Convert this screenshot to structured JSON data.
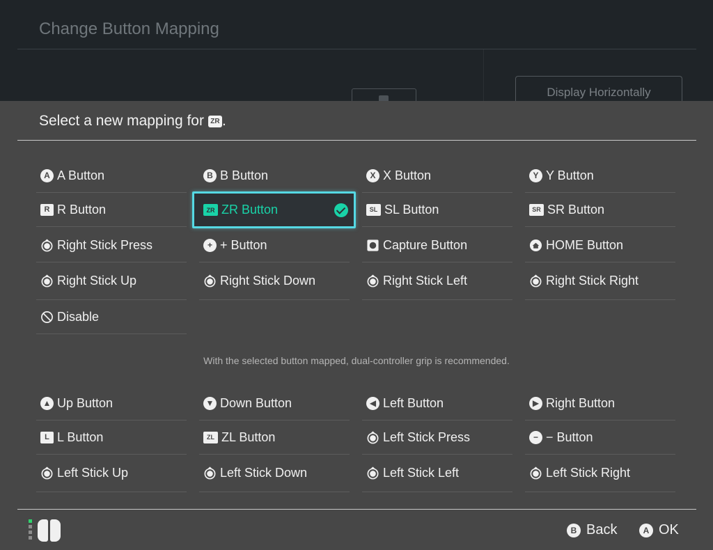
{
  "background": {
    "title": "Change Button Mapping",
    "display_button_label": "Display Horizontally"
  },
  "prompt": {
    "text_before": "Select a new mapping for",
    "icon_label": "ZR",
    "text_after": "."
  },
  "options_primary": [
    {
      "label": "A Button",
      "icon": "a-button-icon",
      "glyph": "A"
    },
    {
      "label": "B Button",
      "icon": "b-button-icon",
      "glyph": "B"
    },
    {
      "label": "X Button",
      "icon": "x-button-icon",
      "glyph": "X"
    },
    {
      "label": "Y Button",
      "icon": "y-button-icon",
      "glyph": "Y"
    },
    {
      "label": "R Button",
      "icon": "r-button-icon",
      "glyph": "R"
    },
    {
      "label": "ZR Button",
      "icon": "zr-button-icon",
      "glyph": "ZR",
      "selected": true
    },
    {
      "label": "SL Button",
      "icon": "sl-button-icon",
      "glyph": "SL"
    },
    {
      "label": "SR Button",
      "icon": "sr-button-icon",
      "glyph": "SR"
    },
    {
      "label": "Right Stick Press",
      "icon": "right-stick-press-icon",
      "glyph": "R"
    },
    {
      "label": "+ Button",
      "icon": "plus-button-icon",
      "glyph": "+"
    },
    {
      "label": "Capture Button",
      "icon": "capture-button-icon",
      "glyph": ""
    },
    {
      "label": "HOME Button",
      "icon": "home-button-icon",
      "glyph": ""
    },
    {
      "label": "Right Stick Up",
      "icon": "right-stick-up-icon",
      "glyph": "R"
    },
    {
      "label": "Right Stick Down",
      "icon": "right-stick-down-icon",
      "glyph": "R"
    },
    {
      "label": "Right Stick Left",
      "icon": "right-stick-left-icon",
      "glyph": "R"
    },
    {
      "label": "Right Stick Right",
      "icon": "right-stick-right-icon",
      "glyph": "R"
    },
    {
      "label": "Disable",
      "icon": "disable-icon",
      "glyph": ""
    }
  ],
  "grip_note": "With the selected button mapped, dual-controller grip is recommended.",
  "options_secondary": [
    {
      "label": "Up Button",
      "icon": "up-button-icon",
      "glyph": "▲"
    },
    {
      "label": "Down Button",
      "icon": "down-button-icon",
      "glyph": "▼"
    },
    {
      "label": "Left Button",
      "icon": "left-button-icon",
      "glyph": "◀"
    },
    {
      "label": "Right Button",
      "icon": "right-button-icon",
      "glyph": "▶"
    },
    {
      "label": "L Button",
      "icon": "l-button-icon",
      "glyph": "L"
    },
    {
      "label": "ZL Button",
      "icon": "zl-button-icon",
      "glyph": "ZL"
    },
    {
      "label": "Left Stick Press",
      "icon": "left-stick-press-icon",
      "glyph": "L"
    },
    {
      "label": "− Button",
      "icon": "minus-button-icon",
      "glyph": "−"
    },
    {
      "label": "Left Stick Up",
      "icon": "left-stick-up-icon",
      "glyph": "L"
    },
    {
      "label": "Left Stick Down",
      "icon": "left-stick-down-icon",
      "glyph": "L"
    },
    {
      "label": "Left Stick Left",
      "icon": "left-stick-left-icon",
      "glyph": "L"
    },
    {
      "label": "Left Stick Right",
      "icon": "left-stick-right-icon",
      "glyph": "L"
    }
  ],
  "footer": {
    "back_key": "B",
    "back_label": "Back",
    "ok_key": "A",
    "ok_label": "OK"
  },
  "colors": {
    "accent_selected": "#19d3a8",
    "selection_border": "#55d9e4",
    "panel_bg": "#474747"
  }
}
